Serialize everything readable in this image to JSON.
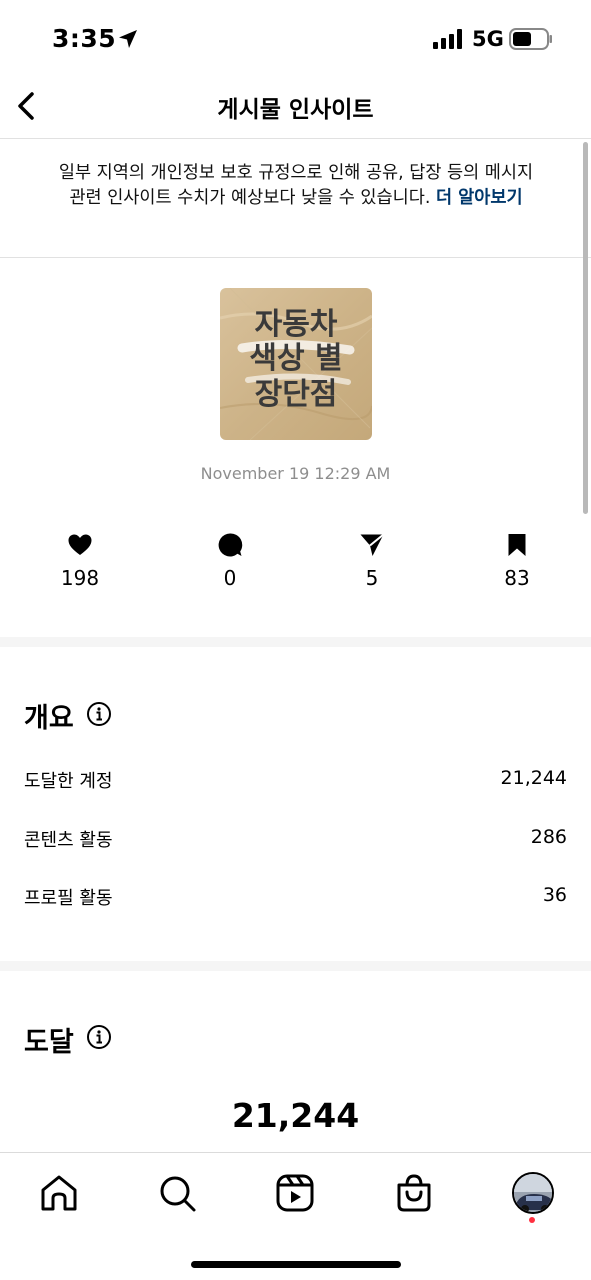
{
  "status": {
    "time": "3:35",
    "network": "5G"
  },
  "header": {
    "title": "게시물 인사이트"
  },
  "notice": {
    "text": "일부 지역의 개인정보 보호 규정으로 인해 공유, 답장 등의 메시지 관련 인사이트 수치가 예상보다 낮을 수 있습니다.",
    "link": "더 알아보기"
  },
  "post": {
    "thumbnail_lines": [
      "자동차",
      "색상 별",
      "장단점"
    ],
    "date": "November 19 12:29 AM"
  },
  "stats": [
    {
      "icon": "heart-icon",
      "value": "198"
    },
    {
      "icon": "comment-icon",
      "value": "0"
    },
    {
      "icon": "share-icon",
      "value": "5"
    },
    {
      "icon": "bookmark-icon",
      "value": "83"
    }
  ],
  "overview": {
    "title": "개요",
    "rows": [
      {
        "label": "도달한 계정",
        "value": "21,244"
      },
      {
        "label": "콘텐츠 활동",
        "value": "286"
      },
      {
        "label": "프로필 활동",
        "value": "36"
      }
    ]
  },
  "reach": {
    "title": "도달",
    "value": "21,244"
  },
  "tabs": [
    "home-icon",
    "search-icon",
    "reels-icon",
    "shop-icon",
    "profile-avatar"
  ],
  "colors": {
    "link": "#00376b",
    "muted": "#8e8e8e",
    "notification_dot": "#ff3040"
  }
}
